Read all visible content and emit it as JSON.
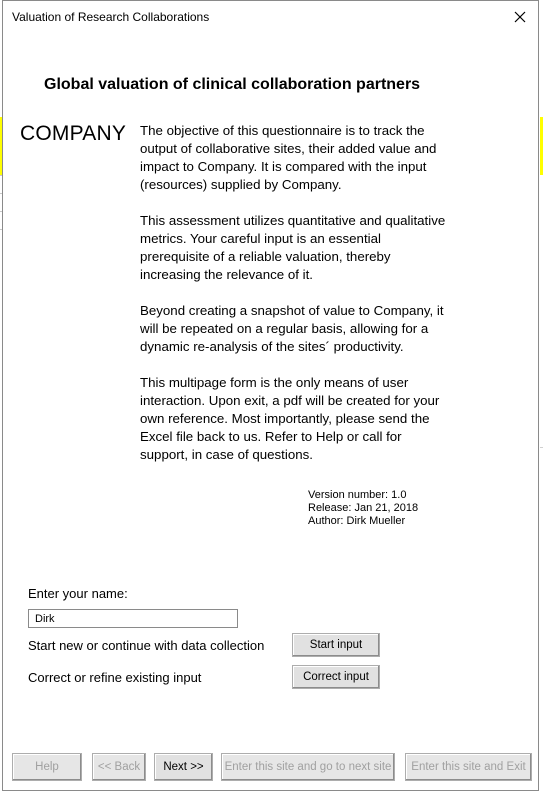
{
  "window": {
    "title": "Valuation of Research Collaborations",
    "close_glyph": "close-icon"
  },
  "heading": "Global valuation of clinical collaboration partners",
  "company_label": "COMPANY",
  "intro": {
    "p1": "The objective of this questionnaire is to track the output of collaborative sites, their added value and impact to Company. It is compared with the input (resources) supplied by Company.",
    "p2": "This assessment utilizes quantitative and qualitative metrics. Your careful input is an essential prerequisite of a reliable valuation, thereby increasing the relevance of it.",
    "p3": "Beyond creating a snapshot of value to Company, it will be repeated on a regular basis, allowing for a dynamic re-analysis of the sites´ productivity.",
    "p4": "This multipage form is the only means of user interaction. Upon exit, a pdf will be created for your own reference. Most importantly, please send the Excel file back to us. Refer to Help or call for support, in case of questions."
  },
  "version": {
    "number": "Version number: 1.0",
    "release": "Release: Jan 21, 2018",
    "author": "Author: Dirk Mueller"
  },
  "form": {
    "name_label": "Enter your name:",
    "name_value": "Dirk",
    "start_label": "Start new or continue with data collection",
    "start_button": "Start input",
    "correct_label": "Correct or refine existing input",
    "correct_button": "Correct input"
  },
  "footer": {
    "help": "Help",
    "back": "<< Back",
    "next": "Next >>",
    "next_site": "Enter this site and go to next site",
    "exit": "Enter this site and Exit"
  },
  "colors": {
    "background_highlight": "#ffff00",
    "button_face": "#e1e1e1",
    "disabled_text": "#a0a0a0"
  }
}
